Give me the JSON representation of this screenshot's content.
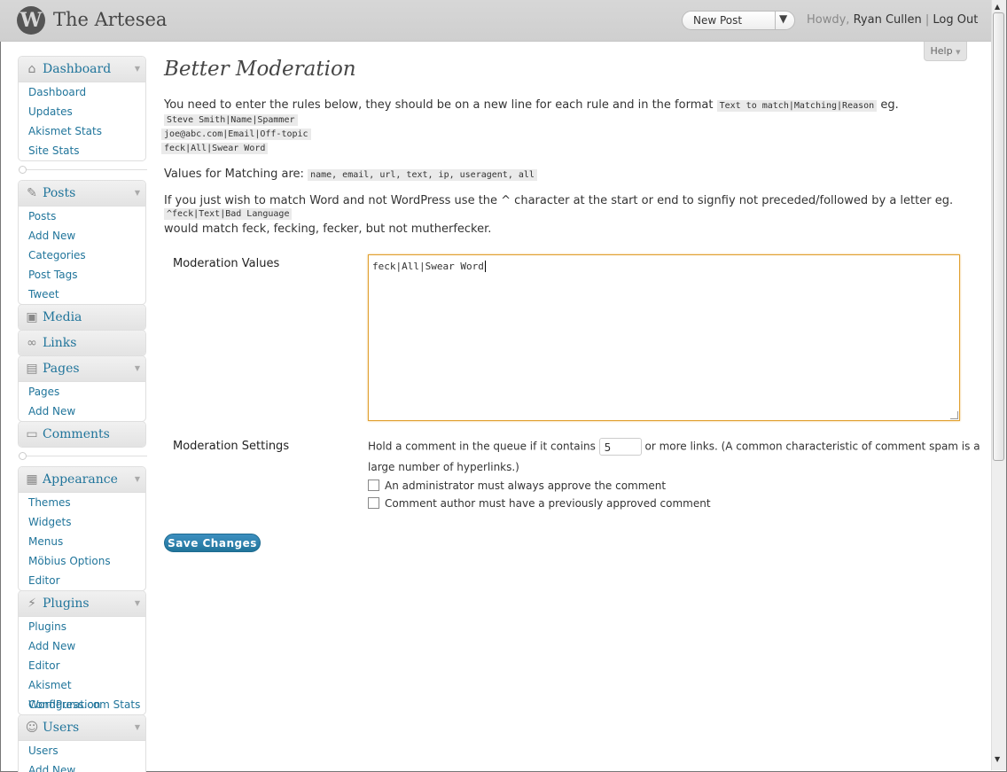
{
  "header": {
    "logo": "W",
    "site_title": "The Artesea",
    "new_post": "New Post",
    "howdy_prefix": "Howdy,",
    "user": "Ryan Cullen",
    "separator": "|",
    "logout": "Log Out",
    "help": "Help"
  },
  "sidebar": {
    "dashboard": {
      "title": "Dashboard",
      "items": [
        "Dashboard",
        "Updates",
        "Akismet Stats",
        "Site Stats"
      ]
    },
    "posts": {
      "title": "Posts",
      "items": [
        "Posts",
        "Add New",
        "Categories",
        "Post Tags",
        "Tweet"
      ]
    },
    "media": {
      "title": "Media"
    },
    "links": {
      "title": "Links"
    },
    "pages": {
      "title": "Pages",
      "items": [
        "Pages",
        "Add New"
      ]
    },
    "comments": {
      "title": "Comments"
    },
    "appearance": {
      "title": "Appearance",
      "items": [
        "Themes",
        "Widgets",
        "Menus",
        "Möbius Options",
        "Editor"
      ]
    },
    "plugins": {
      "title": "Plugins",
      "items": [
        "Plugins",
        "Add New",
        "Editor",
        "Akismet Configuration",
        "WordPress.com Stats"
      ]
    },
    "users": {
      "title": "Users",
      "items": [
        "Users",
        "Add New"
      ]
    }
  },
  "main": {
    "title": "Better Moderation",
    "intro_text": "You need to enter the rules below, they should be on a new line for each rule and in the format",
    "intro_format": "Text to match|Matching|Reason",
    "intro_eg": "eg.",
    "examples": [
      "Steve Smith|Name|Spammer",
      "joe@abc.com|Email|Off-topic",
      "feck|All|Swear Word"
    ],
    "matching_text": "Values for Matching are:",
    "matching_values": "name, email, url, text, ip, useragent, all",
    "caret_text": "If you just wish to match Word and not WordPress use the ^ character at the start or end to signfiy not preceded/followed by a letter eg.",
    "caret_example": "^feck|Text|Bad Language",
    "caret_result": "would match feck, fecking, fecker, but not mutherfecker.",
    "moderation_values_label": "Moderation Values",
    "moderation_values": "feck|All|Swear Word",
    "moderation_settings_label": "Moderation Settings",
    "hold_prefix": "Hold a comment in the queue if it contains",
    "hold_links_value": "5",
    "hold_suffix": "or more links. (A common characteristic of comment spam is a",
    "hold_suffix2": "large number of hyperlinks.)",
    "checkbox_admin": "An administrator must always approve the comment",
    "checkbox_author": "Comment author must have a previously approved comment",
    "save": "Save Changes"
  }
}
